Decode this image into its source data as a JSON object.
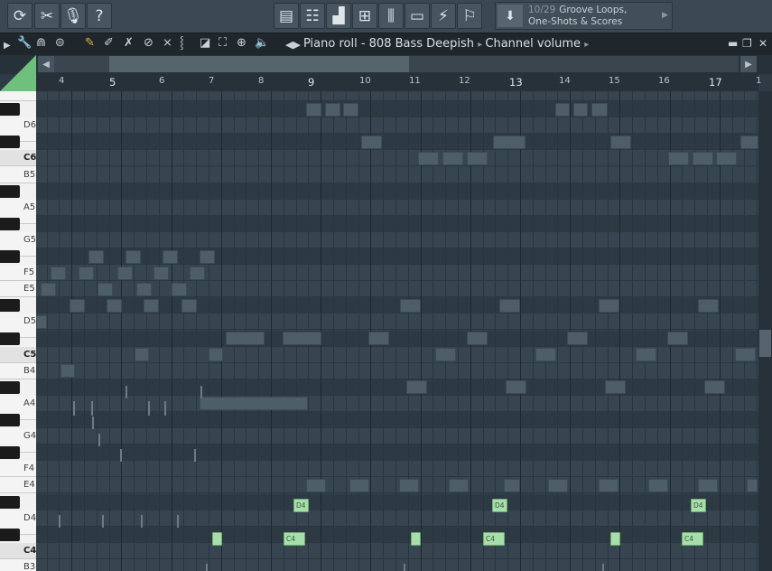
{
  "toolbar": {
    "buttons": [
      {
        "icon": "refresh-icon",
        "glyph": "⟳"
      },
      {
        "icon": "cut-icon",
        "glyph": "✂"
      },
      {
        "icon": "microphone-icon",
        "glyph": "🎙"
      },
      {
        "icon": "help-icon",
        "glyph": "?"
      },
      {
        "icon": "playlist-icon",
        "glyph": "▤"
      },
      {
        "icon": "step-sequencer-icon",
        "glyph": "☷"
      },
      {
        "icon": "piano-roll-icon",
        "glyph": "▟"
      },
      {
        "icon": "browser-icon",
        "glyph": "⊞"
      },
      {
        "icon": "mixer-icon",
        "glyph": "⫼"
      },
      {
        "icon": "channel-rack-icon",
        "glyph": "▭"
      },
      {
        "icon": "plugin-icon",
        "glyph": "⚡"
      },
      {
        "icon": "performance-icon",
        "glyph": "⚐"
      }
    ],
    "browser_hint": {
      "icon": "download-icon",
      "number": "10/29",
      "line1": "Groove Loops,",
      "line2": "One-Shots & Scores"
    }
  },
  "titlebar": {
    "title_prefix": "Piano roll - 808 Bass Deepish",
    "title_suffix": "Channel volume",
    "tools": [
      "wrench-icon",
      "magnet-icon",
      "menu-icon",
      "pencil-icon",
      "brush-icon",
      "delete-icon",
      "mute-icon",
      "slice-icon",
      "select-icon",
      "zoom-icon",
      "playback-icon",
      "speaker-icon"
    ]
  },
  "ruler": {
    "bars": [
      "4",
      "5",
      "6",
      "7",
      "8",
      "9",
      "10",
      "11",
      "12",
      "13",
      "14",
      "15",
      "16",
      "17",
      "1"
    ]
  },
  "keyboard": {
    "labels": [
      "D6",
      "C6",
      "B5",
      "A5",
      "G5",
      "F5",
      "E5",
      "D5",
      "C5",
      "B4",
      "A4",
      "G4",
      "F4",
      "E4",
      "D4",
      "C4",
      "B3"
    ]
  },
  "notes": {
    "active_labels": [
      "D4",
      "C4",
      "D4",
      "C4",
      "D4",
      "C4"
    ]
  },
  "colors": {
    "active_note": "#a6dfa9",
    "ghost_note": "#4e5e69",
    "accent": "#6fc07d"
  }
}
